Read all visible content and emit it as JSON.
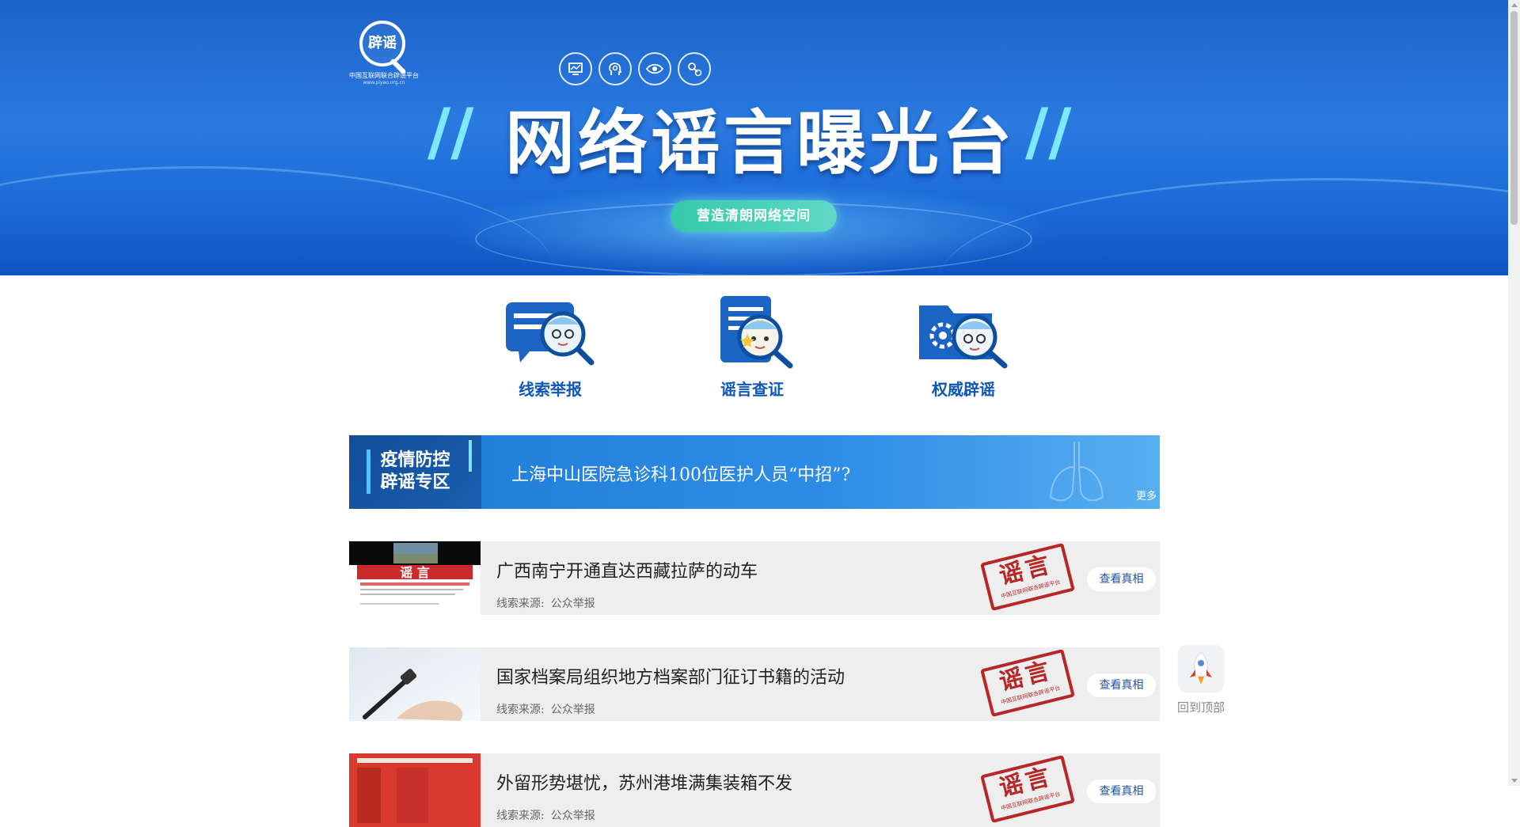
{
  "banner": {
    "logo_mark": "辟谣",
    "logo_subtitle": "中国互联网联合辟谣平台",
    "logo_url": "www.piyao.org.cn",
    "title": "网络谣言曝光台",
    "slogan": "营造清朗网络空间",
    "icons": [
      "monitor-icon",
      "head-gear-icon",
      "eye-icon",
      "magnifier-gear-icon"
    ]
  },
  "features": [
    {
      "label": "线索举报",
      "icon": "report-clue-icon"
    },
    {
      "label": "谣言查证",
      "icon": "rumor-verify-icon"
    },
    {
      "label": "权威辟谣",
      "icon": "authority-debunk-icon"
    }
  ],
  "epidemic": {
    "badge_line1": "疫情防控",
    "badge_line2": "辟谣专区",
    "headline": "上海中山医院急诊科100位医护人员“中招”?",
    "more": "更多"
  },
  "list": {
    "source_label": "线索来源:",
    "stamp_text": "谣言",
    "stamp_small": "中国互联网联合辟谣平台",
    "truth_label": "查看真相",
    "items": [
      {
        "title": "广西南宁开通直达西藏拉萨的动车",
        "source": "公众举报"
      },
      {
        "title": "国家档案局组织地方档案部门征订书籍的活动",
        "source": "公众举报"
      },
      {
        "title": "外留形势堪忧，苏州港堆满集装箱不发",
        "source": "公众举报"
      }
    ]
  },
  "back_to_top": "回到顶部",
  "colors": {
    "accent_blue": "#0d57b6",
    "stamp_red": "#b72727",
    "slogan_green": "#35c9a9"
  }
}
